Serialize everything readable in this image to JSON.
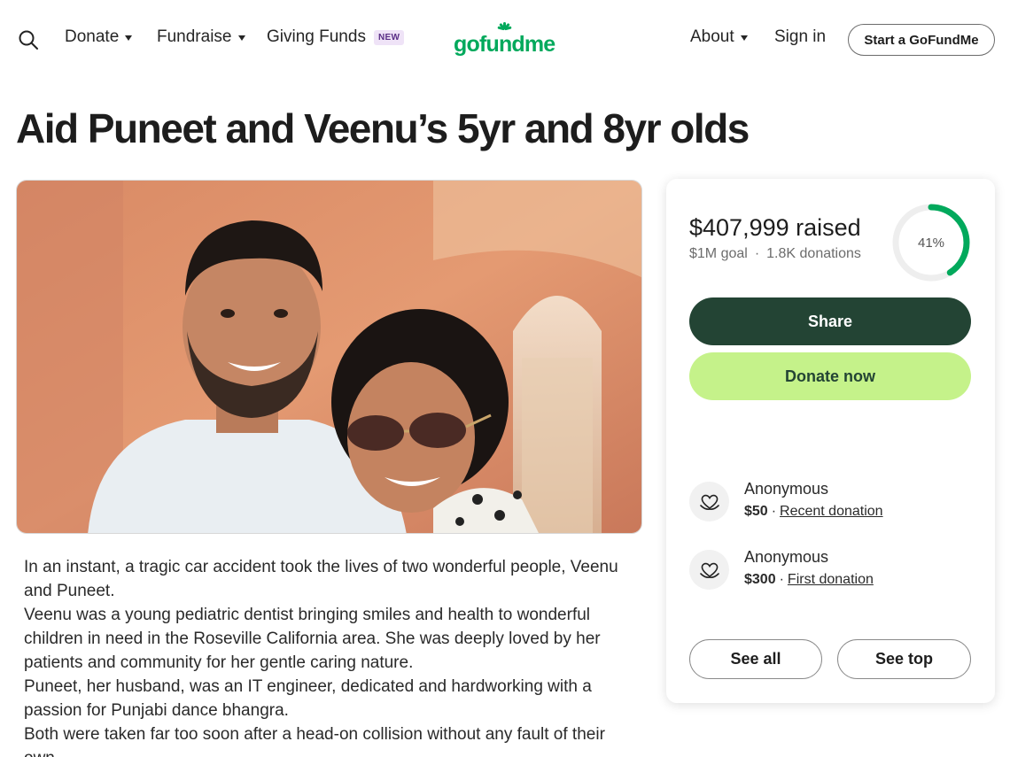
{
  "header": {
    "nav": {
      "donate": "Donate",
      "fundraise": "Fundraise",
      "giving_funds": "Giving Funds",
      "giving_funds_badge": "NEW",
      "about": "About",
      "sign_in": "Sign in"
    },
    "logo_text": "gofundme",
    "start_button": "Start a GoFundMe"
  },
  "campaign": {
    "title": "Aid Puneet and Veenu’s 5yr and 8yr olds",
    "story": [
      "In an instant, a tragic car accident took the lives of two wonderful people, Veenu and Puneet.",
      "Veenu was a young pediatric dentist bringing smiles and health to wonderful children in need in the Roseville California area. She was deeply loved by her patients and community for her gentle caring nature.",
      "Puneet, her husband, was an IT engineer, dedicated and hardworking with a passion for Punjabi dance bhangra.",
      "Both were taken far too soon after a head-on collision without any fault of their own."
    ]
  },
  "donation_card": {
    "raised": "$407,999 raised",
    "goal": "$1M goal",
    "donation_count": "1.8K donations",
    "progress_percent": 41,
    "progress_label": "41%",
    "share_button": "Share",
    "donate_button": "Donate now",
    "donors": [
      {
        "name": "Anonymous",
        "amount": "$50",
        "tag": "Recent donation"
      },
      {
        "name": "Anonymous",
        "amount": "$300",
        "tag": "First donation"
      }
    ],
    "see_all_button": "See all",
    "see_top_button": "See top"
  },
  "colors": {
    "brand_green": "#02a95c",
    "share_bg": "#234434",
    "donate_bg": "#c5f28a",
    "badge_bg": "#efe3f7"
  }
}
